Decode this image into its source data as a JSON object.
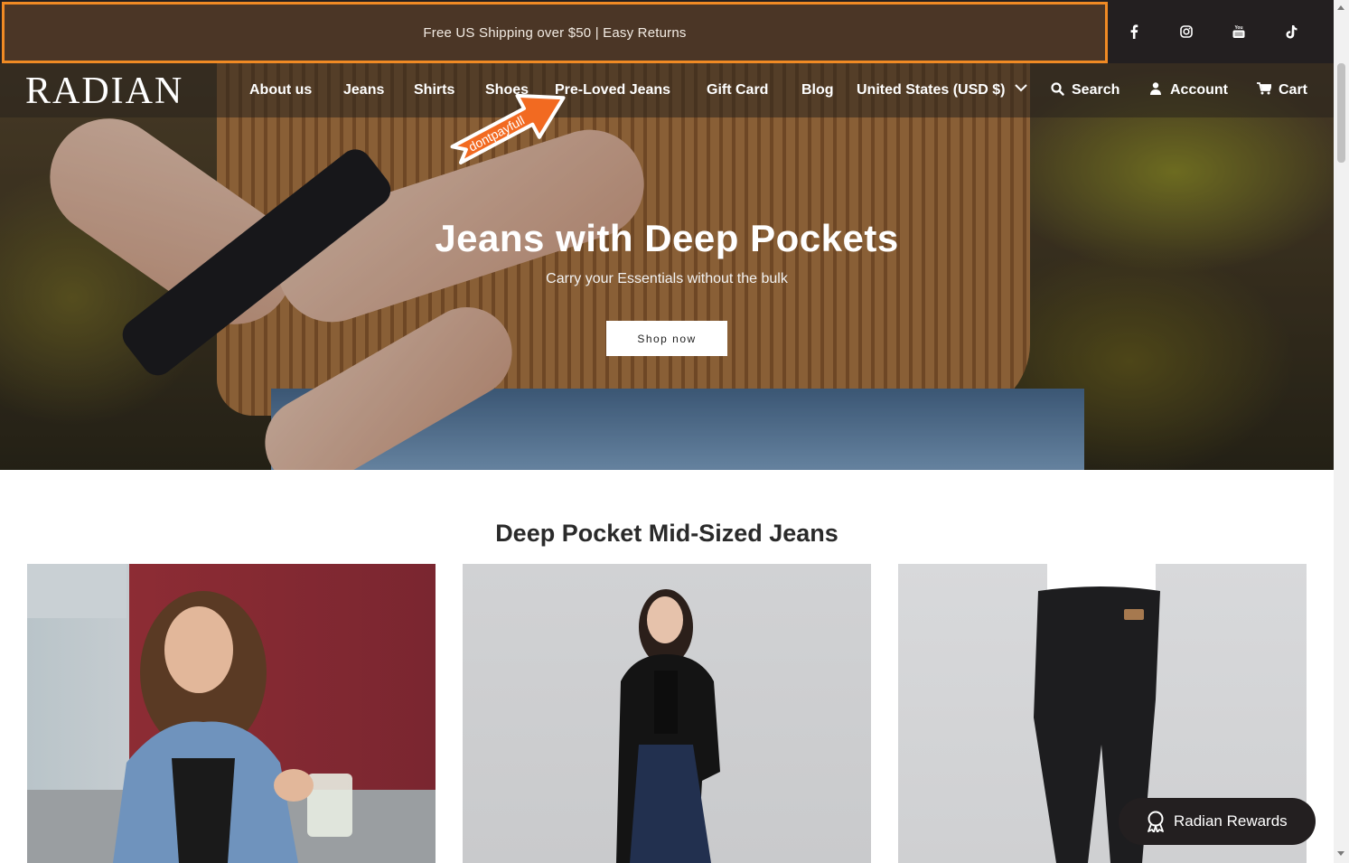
{
  "announcement": {
    "text": "Free US Shipping over $50 | Easy Returns"
  },
  "social": [
    {
      "icon": "facebook-icon"
    },
    {
      "icon": "instagram-icon"
    },
    {
      "icon": "youtube-icon"
    },
    {
      "icon": "tiktok-icon"
    }
  ],
  "brand": {
    "logo": "RADIAN"
  },
  "nav": {
    "items": [
      "About us",
      "Jeans",
      "Shirts",
      "Shoes",
      "Pre-Loved Jeans",
      "Gift Card",
      "Blog"
    ],
    "currency": "United States (USD $)",
    "search": "Search",
    "account": "Account",
    "cart": "Cart"
  },
  "watermark": {
    "arrow_text": "dontpayfull"
  },
  "hero": {
    "title": "Jeans with Deep Pockets",
    "subtitle": "Carry your Essentials without the bulk",
    "cta": "Shop now"
  },
  "section": {
    "title": "Deep Pocket Mid-Sized Jeans"
  },
  "rewards": {
    "label": "Radian Rewards"
  },
  "colors": {
    "announcement_bg": "#4b3626",
    "highlight_border": "#f08a24",
    "topbar_bg": "#231f20",
    "rewards_bg": "#231f20"
  }
}
